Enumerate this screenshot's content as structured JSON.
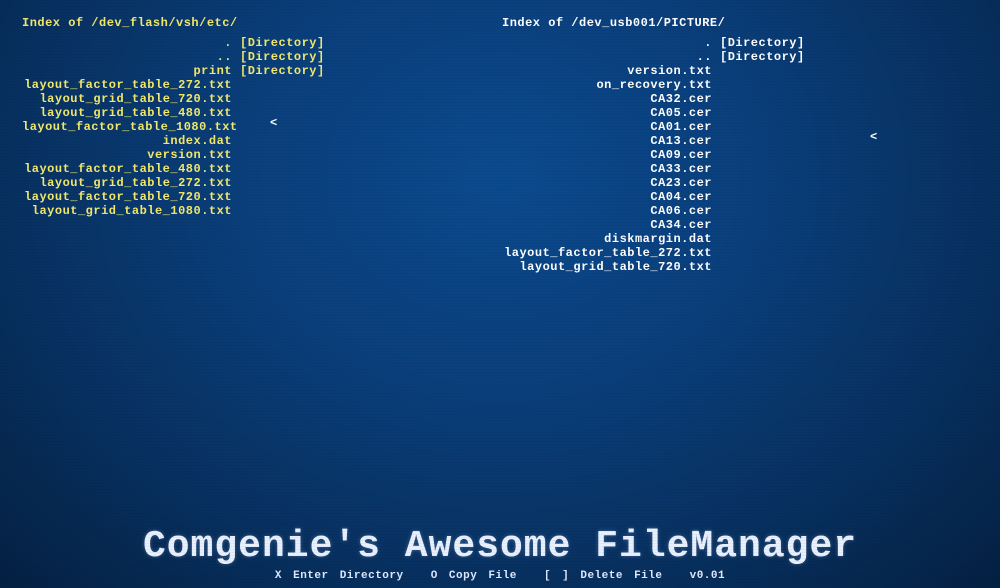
{
  "left": {
    "path": "Index of /dev_flash/vsh/etc/",
    "entries": [
      {
        "name": ".",
        "type": "[Directory]"
      },
      {
        "name": "..",
        "type": "[Directory]"
      },
      {
        "name": "print",
        "type": "[Directory]"
      },
      {
        "name": "layout_factor_table_272.txt",
        "type": ""
      },
      {
        "name": "layout_grid_table_720.txt",
        "type": ""
      },
      {
        "name": "layout_grid_table_480.txt",
        "type": ""
      },
      {
        "name": "layout_factor_table_1080.txt",
        "type": ""
      },
      {
        "name": "index.dat",
        "type": ""
      },
      {
        "name": "version.txt",
        "type": ""
      },
      {
        "name": "layout_factor_table_480.txt",
        "type": ""
      },
      {
        "name": "layout_grid_table_272.txt",
        "type": ""
      },
      {
        "name": "layout_factor_table_720.txt",
        "type": ""
      },
      {
        "name": "layout_grid_table_1080.txt",
        "type": ""
      }
    ],
    "cursor_index": 8
  },
  "right": {
    "path": "Index of /dev_usb001/PICTURE/",
    "entries": [
      {
        "name": ".",
        "type": "[Directory]"
      },
      {
        "name": "..",
        "type": "[Directory]"
      },
      {
        "name": "version.txt",
        "type": ""
      },
      {
        "name": "on_recovery.txt",
        "type": ""
      },
      {
        "name": "CA32.cer",
        "type": ""
      },
      {
        "name": "CA05.cer",
        "type": ""
      },
      {
        "name": "CA01.cer",
        "type": ""
      },
      {
        "name": "CA13.cer",
        "type": ""
      },
      {
        "name": "CA09.cer",
        "type": ""
      },
      {
        "name": "CA33.cer",
        "type": ""
      },
      {
        "name": "CA23.cer",
        "type": ""
      },
      {
        "name": "CA04.cer",
        "type": ""
      },
      {
        "name": "CA06.cer",
        "type": ""
      },
      {
        "name": "CA34.cer",
        "type": ""
      },
      {
        "name": "diskmargin.dat",
        "type": ""
      },
      {
        "name": "layout_factor_table_272.txt",
        "type": ""
      },
      {
        "name": "layout_grid_table_720.txt",
        "type": ""
      }
    ],
    "cursor_index": 9
  },
  "cursor_glyph": "<",
  "app_title": "Comgenie's Awesome FileManager",
  "hints": {
    "enter": "X Enter Directory",
    "copy": "O Copy File",
    "delete": "[ ] Delete File"
  },
  "version": "v0.01"
}
